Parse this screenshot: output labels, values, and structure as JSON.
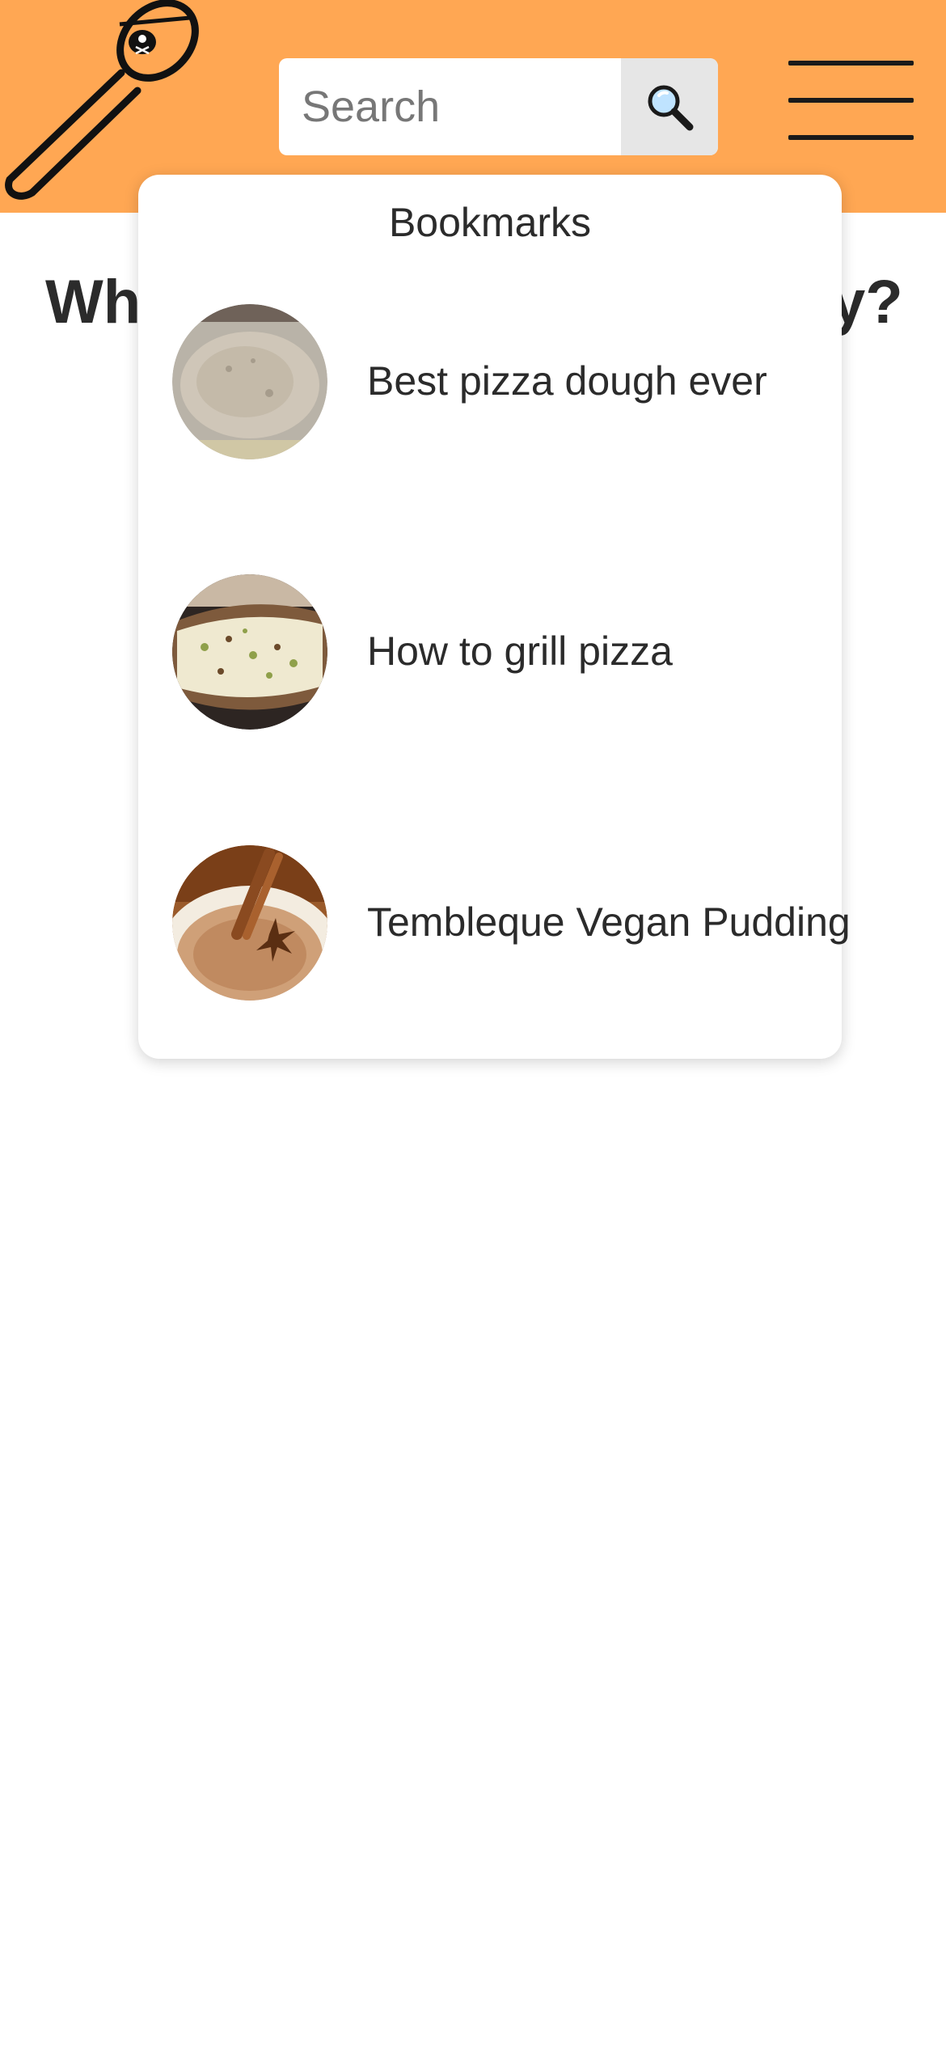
{
  "header": {
    "background": "#FFA753",
    "logo_icon": "pirate-spoon-logo"
  },
  "search": {
    "placeholder": "Search",
    "value": "",
    "button_icon": "magnifier-icon"
  },
  "menu": {
    "icon": "hamburger-menu-icon"
  },
  "greeting": {
    "visible_left": "Wha",
    "visible_right": "y?"
  },
  "bookmarks": {
    "title": "Bookmarks",
    "items": [
      {
        "label": "Best pizza dough ever",
        "thumb": "pizza-dough-photo"
      },
      {
        "label": "How to grill pizza",
        "thumb": "grilled-pizza-photo"
      },
      {
        "label": "Tembleque Vegan Pudding",
        "thumb": "pudding-photo"
      }
    ]
  }
}
